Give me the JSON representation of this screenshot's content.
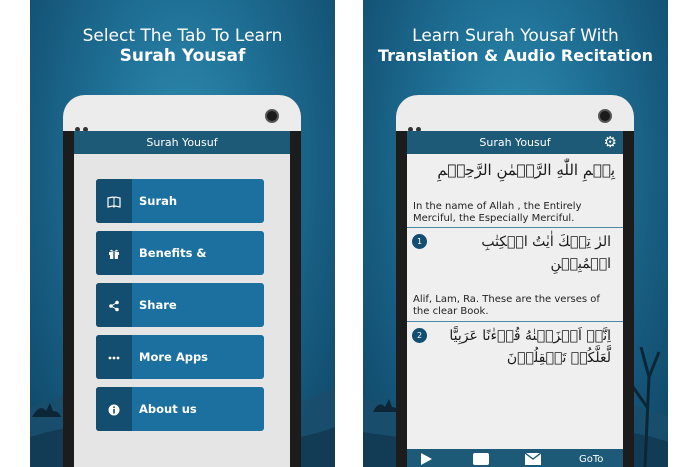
{
  "left_panel": {
    "headline_line1": "Select The Tab To Learn",
    "headline_line2": "Surah Yousaf",
    "app_title": "Surah Yousuf",
    "menu": [
      {
        "label": "Surah",
        "icon": "book-icon"
      },
      {
        "label": "Benefits & Blessings",
        "icon": "gift-icon"
      },
      {
        "label": "Share",
        "icon": "share-icon"
      },
      {
        "label": "More Apps",
        "icon": "more-dots-icon"
      },
      {
        "label": "About us",
        "icon": "info-icon"
      }
    ]
  },
  "right_panel": {
    "headline_line1": "Learn Surah Yousaf  With",
    "headline_line2": "Translation & Audio Recitation",
    "app_title": "Surah Yousuf",
    "bismillah": "بِسۡمِ اللّٰهِ الرَّحۡمٰنِ الرَّحِيۡمِ",
    "bismillah_translation": "In the name of Allah , the Entirely Merciful, the Especially Merciful.",
    "verses": [
      {
        "number": "1",
        "arabic": "الرٰ تِلۡكَ اٰيٰتُ الۡكِتٰبِ الۡمُبِيۡنِ",
        "translation": "Alif, Lam, Ra. These are the verses of the clear Book."
      },
      {
        "number": "2",
        "arabic": "اِنَّاۤ اَنۡزَلۡنٰهُ قُرۡءٰنًا عَرَبِيًّا لَّعَلَّكُمۡ تَعۡقِلُوۡنَ",
        "translation": ""
      }
    ],
    "bottom_bar": {
      "goto_label": "GoTo"
    }
  },
  "colors": {
    "primary": "#1b70a0",
    "primary_dark": "#134d6f",
    "appbar": "#1d5a78",
    "background": "#1f6f95"
  }
}
